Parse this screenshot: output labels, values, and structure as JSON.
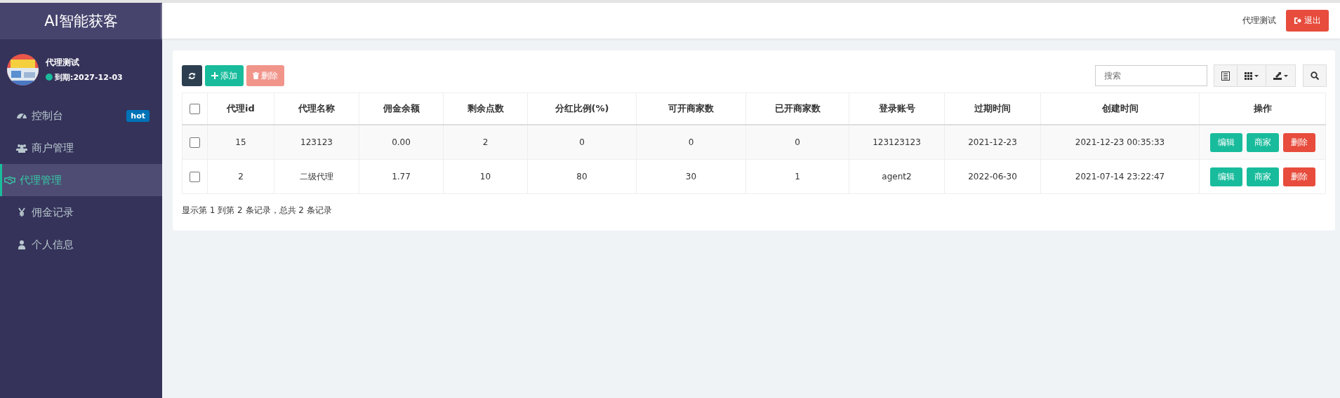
{
  "sidebar": {
    "brand": "AI智能获客",
    "user": {
      "name": "代理测试",
      "online": true,
      "expiry": "到期:2027-12-03"
    },
    "items": [
      {
        "kind": "dashboard",
        "label": "控制台",
        "badge": "hot",
        "selected": false
      },
      {
        "kind": "users",
        "label": "商户管理",
        "selected": false
      },
      {
        "kind": "handshake",
        "label": "代理管理",
        "selected": true
      },
      {
        "kind": "yen",
        "label": "佣金记录",
        "selected": false
      },
      {
        "kind": "user",
        "label": "个人信息",
        "selected": false
      }
    ]
  },
  "header": {
    "username": "代理测试",
    "logout": "退出"
  },
  "toolbar": {
    "add": "添加",
    "delete": {
      "label": "删除",
      "disabled": true
    },
    "search": {
      "placeholder": "搜索"
    }
  },
  "table": {
    "columns": [
      "代理id",
      "代理名称",
      "佣金余额",
      "剩余点数",
      "分红比例(%)",
      "可开商家数",
      "已开商家数",
      "登录账号",
      "过期时间",
      "创建时间",
      "操作"
    ],
    "select_all": {
      "checked": false
    },
    "rows": [
      {
        "checked": false,
        "cells": [
          "15",
          "123123",
          "0.00",
          "2",
          "0",
          "0",
          "0",
          "123123123",
          "2021-12-23",
          "2021-12-23 00:35:33"
        ],
        "actions": [
          "编辑",
          "商家",
          "删除"
        ]
      },
      {
        "checked": false,
        "cells": [
          "2",
          "二级代理",
          "1.77",
          "10",
          "80",
          "30",
          "1",
          "agent2",
          "2022-06-30",
          "2021-07-14 23:22:47"
        ],
        "actions": [
          "编辑",
          "商家",
          "删除"
        ]
      }
    ]
  },
  "pagination_info": "显示第 1 到第 2 条记录，总共 2 条记录"
}
